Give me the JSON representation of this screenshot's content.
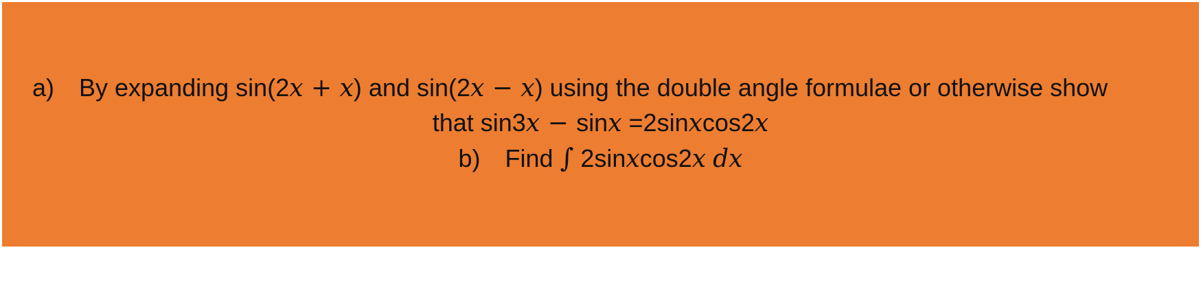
{
  "question": {
    "part_a": {
      "label": "a)",
      "t1": "By expanding sin(2",
      "v1": "x",
      "op1": " + ",
      "v2": "x",
      "t2": ") and sin(2",
      "v3": "x",
      "op2": " − ",
      "v4": "x",
      "t3": ") using the double angle formulae or otherwise show",
      "t4": "that sin3",
      "v5": "x",
      "op3": " − ",
      "t5": "sin",
      "v6": "x",
      "t6": " =2sin",
      "v7": "x",
      "t7": "cos2",
      "v8": "x"
    },
    "part_b": {
      "label": "b)",
      "t1": "Find ",
      "integral": "∫",
      "t2": " 2sin",
      "v1": "x",
      "t3": "cos2",
      "v2": "x",
      "t4": " ",
      "d": "dx"
    }
  },
  "colors": {
    "box_background": "#ed7d31",
    "text": "#111111",
    "page_background": "#ffffff"
  }
}
